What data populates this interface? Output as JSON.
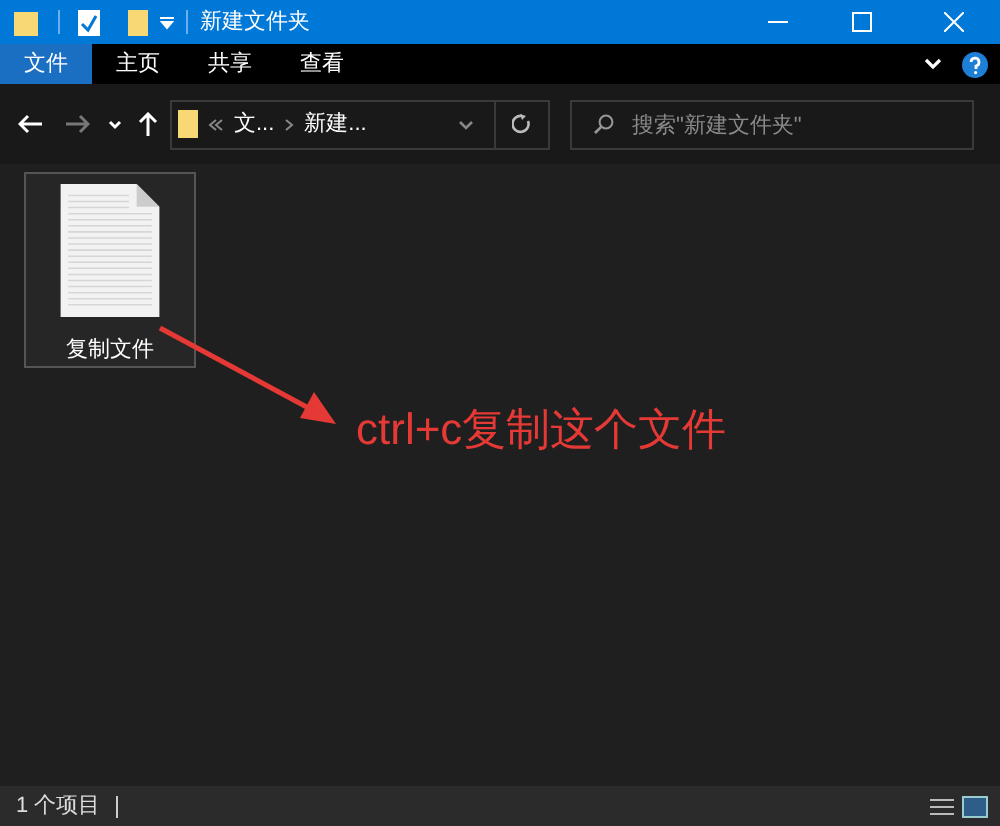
{
  "window": {
    "title": "新建文件夹"
  },
  "ribbon_tabs": [
    {
      "label": "文件",
      "selected": true
    },
    {
      "label": "主页",
      "selected": false
    },
    {
      "label": "共享",
      "selected": false
    },
    {
      "label": "查看",
      "selected": false
    }
  ],
  "address_bar": {
    "crumbs": [
      "文...",
      "新建..."
    ]
  },
  "search": {
    "placeholder": "搜索\"新建文件夹\""
  },
  "files": [
    {
      "name": "复制文件",
      "selected": true
    }
  ],
  "annotation": {
    "text": "ctrl+c复制这个文件"
  },
  "status_bar": {
    "count": "1 个项目"
  }
}
